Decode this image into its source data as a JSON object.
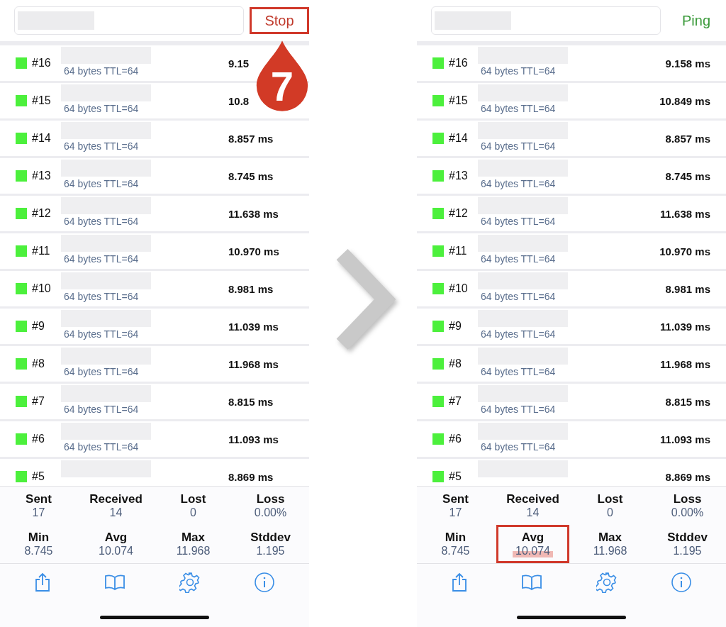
{
  "panels": [
    {
      "action": {
        "label": "Stop",
        "kind": "stop",
        "highlighted": true
      },
      "rows": [
        {
          "index": "#16",
          "subtitle": "64 bytes TTL=64",
          "time": "9.15"
        },
        {
          "index": "#15",
          "subtitle": "64 bytes TTL=64",
          "time": "10.8"
        },
        {
          "index": "#14",
          "subtitle": "64 bytes TTL=64",
          "time": "8.857 ms"
        },
        {
          "index": "#13",
          "subtitle": "64 bytes TTL=64",
          "time": "8.745 ms"
        },
        {
          "index": "#12",
          "subtitle": "64 bytes TTL=64",
          "time": "11.638 ms"
        },
        {
          "index": "#11",
          "subtitle": "64 bytes TTL=64",
          "time": "10.970 ms"
        },
        {
          "index": "#10",
          "subtitle": "64 bytes TTL=64",
          "time": "8.981 ms"
        },
        {
          "index": "#9",
          "subtitle": "64 bytes TTL=64",
          "time": "11.039 ms"
        },
        {
          "index": "#8",
          "subtitle": "64 bytes TTL=64",
          "time": "11.968 ms"
        },
        {
          "index": "#7",
          "subtitle": "64 bytes TTL=64",
          "time": "8.815 ms"
        },
        {
          "index": "#6",
          "subtitle": "64 bytes TTL=64",
          "time": "11.093 ms"
        },
        {
          "index": "#5",
          "time": "8.869 ms"
        }
      ],
      "stats": [
        {
          "label": "Sent",
          "value": "17",
          "highlighted": false
        },
        {
          "label": "Received",
          "value": "14",
          "highlighted": false
        },
        {
          "label": "Lost",
          "value": "0",
          "highlighted": false
        },
        {
          "label": "Loss",
          "value": "0.00%",
          "highlighted": false
        },
        {
          "label": "Min",
          "value": "8.745",
          "highlighted": false
        },
        {
          "label": "Avg",
          "value": "10.074",
          "highlighted": false
        },
        {
          "label": "Max",
          "value": "11.968",
          "highlighted": false
        },
        {
          "label": "Stddev",
          "value": "1.195",
          "highlighted": false
        }
      ],
      "callout": {
        "number": "7"
      }
    },
    {
      "action": {
        "label": "Ping",
        "kind": "ping",
        "highlighted": false
      },
      "rows": [
        {
          "index": "#16",
          "subtitle": "64 bytes TTL=64",
          "time": "9.158 ms"
        },
        {
          "index": "#15",
          "subtitle": "64 bytes TTL=64",
          "time": "10.849 ms"
        },
        {
          "index": "#14",
          "subtitle": "64 bytes TTL=64",
          "time": "8.857 ms"
        },
        {
          "index": "#13",
          "subtitle": "64 bytes TTL=64",
          "time": "8.745 ms"
        },
        {
          "index": "#12",
          "subtitle": "64 bytes TTL=64",
          "time": "11.638 ms"
        },
        {
          "index": "#11",
          "subtitle": "64 bytes TTL=64",
          "time": "10.970 ms"
        },
        {
          "index": "#10",
          "subtitle": "64 bytes TTL=64",
          "time": "8.981 ms"
        },
        {
          "index": "#9",
          "subtitle": "64 bytes TTL=64",
          "time": "11.039 ms"
        },
        {
          "index": "#8",
          "subtitle": "64 bytes TTL=64",
          "time": "11.968 ms"
        },
        {
          "index": "#7",
          "subtitle": "64 bytes TTL=64",
          "time": "8.815 ms"
        },
        {
          "index": "#6",
          "subtitle": "64 bytes TTL=64",
          "time": "11.093 ms"
        },
        {
          "index": "#5",
          "time": "8.869 ms"
        }
      ],
      "stats": [
        {
          "label": "Sent",
          "value": "17",
          "highlighted": false
        },
        {
          "label": "Received",
          "value": "14",
          "highlighted": false
        },
        {
          "label": "Lost",
          "value": "0",
          "highlighted": false
        },
        {
          "label": "Loss",
          "value": "0.00%",
          "highlighted": false
        },
        {
          "label": "Min",
          "value": "8.745",
          "highlighted": false
        },
        {
          "label": "Avg",
          "value": "10.074",
          "highlighted": true
        },
        {
          "label": "Max",
          "value": "11.968",
          "highlighted": false
        },
        {
          "label": "Stddev",
          "value": "1.195",
          "highlighted": false
        }
      ]
    }
  ]
}
